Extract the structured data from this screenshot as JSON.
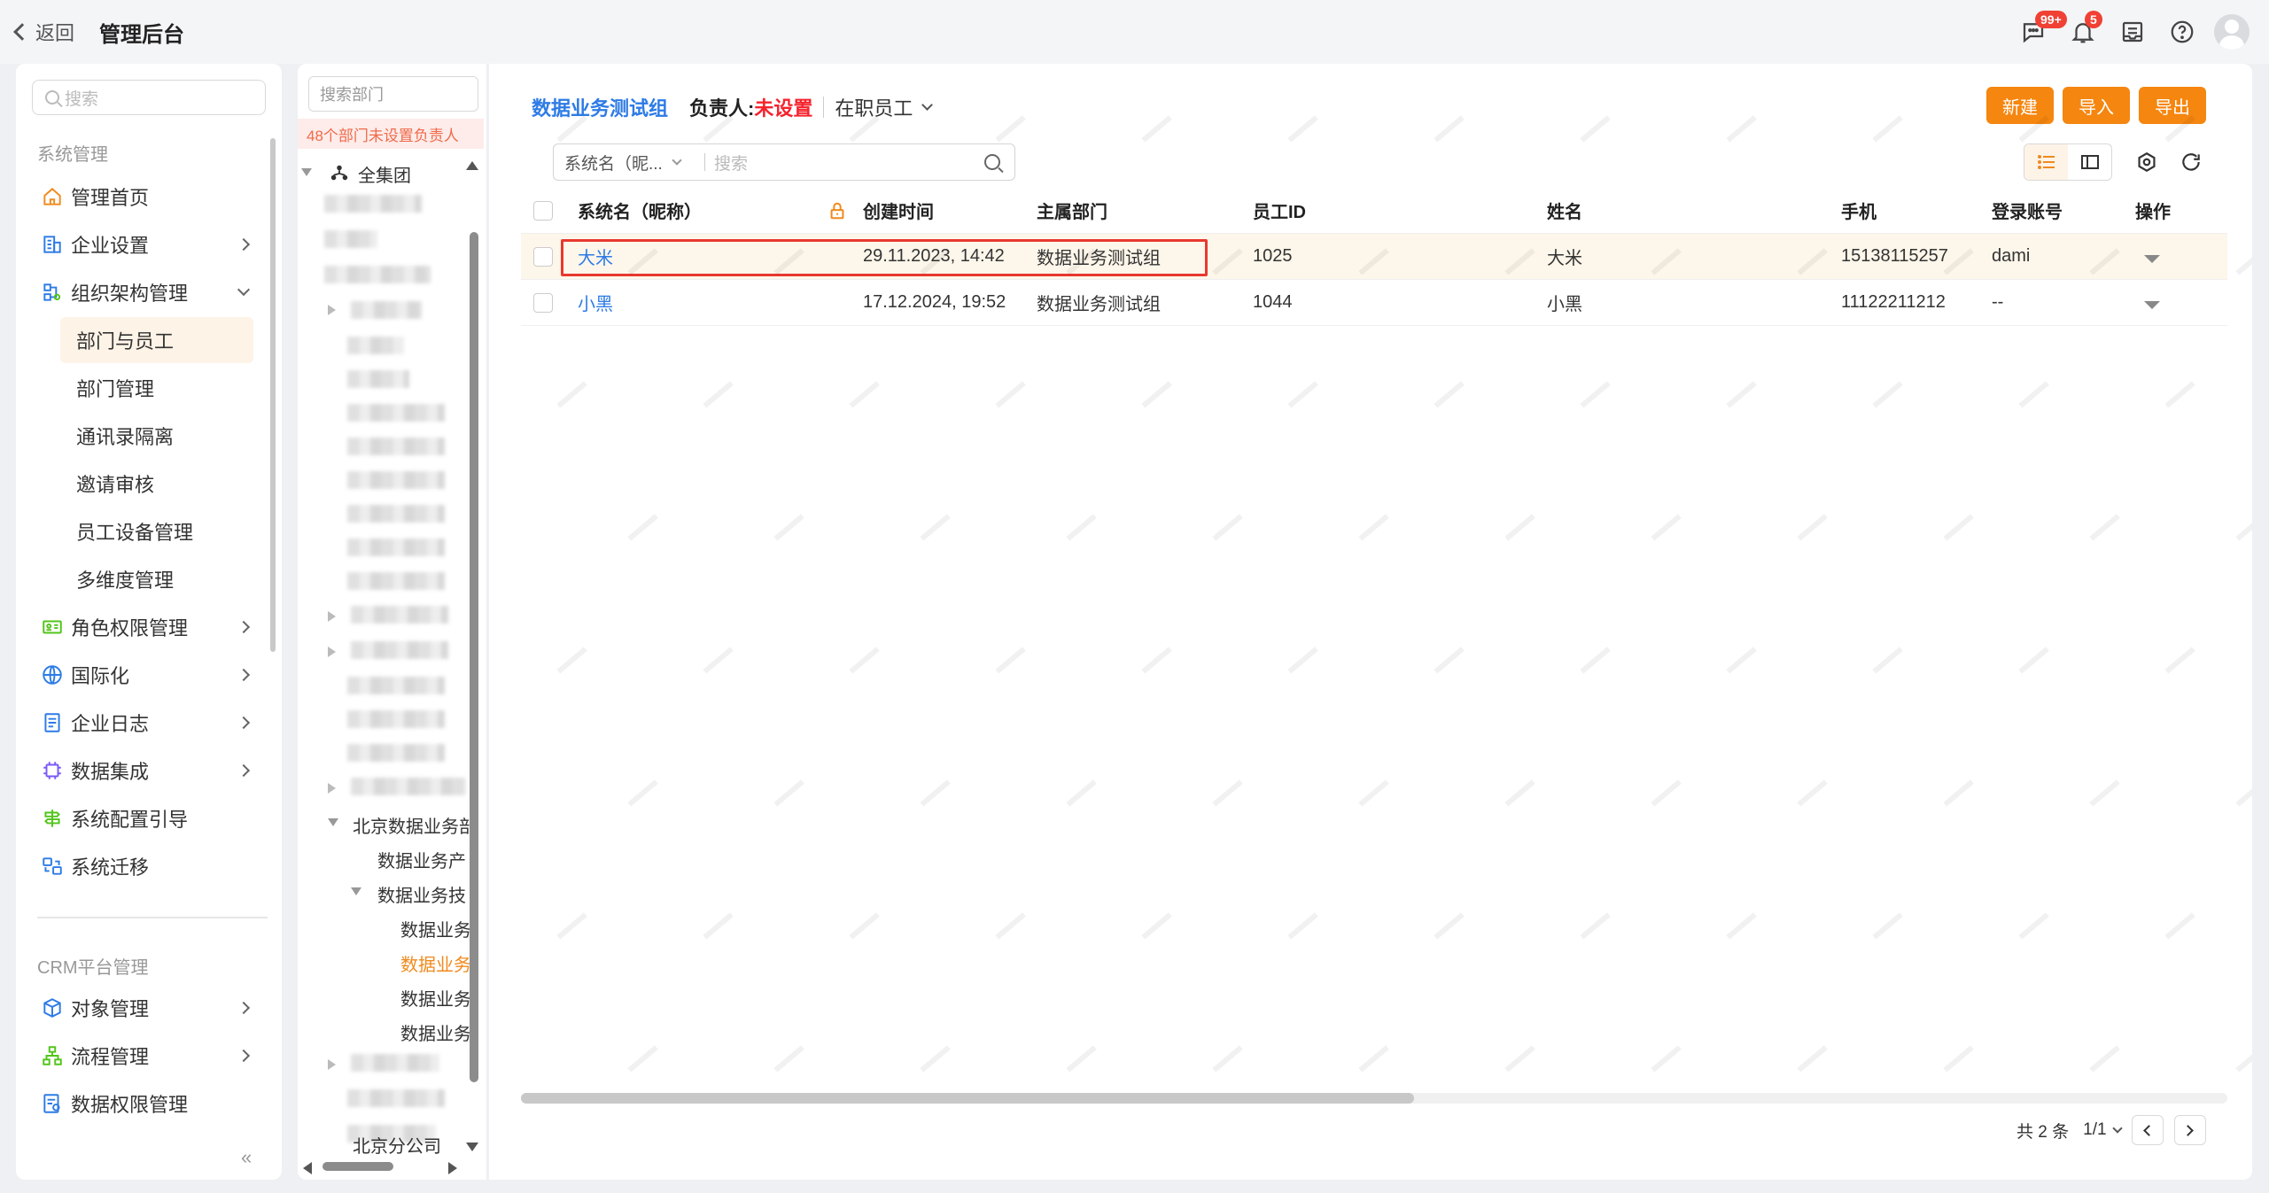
{
  "topbar": {
    "back_label": "返回",
    "title": "管理后台",
    "chat_badge": "99+",
    "bell_badge": "5"
  },
  "sidebar": {
    "search_placeholder": "搜索",
    "group_system": "系统管理",
    "group_crm": "CRM平台管理",
    "items": [
      {
        "label": "管理首页",
        "icon": "home-icon"
      },
      {
        "label": "企业设置",
        "icon": "building-icon"
      },
      {
        "label": "组织架构管理",
        "icon": "org-icon"
      },
      {
        "label": "角色权限管理",
        "icon": "role-icon"
      },
      {
        "label": "国际化",
        "icon": "globe-icon"
      },
      {
        "label": "企业日志",
        "icon": "log-icon"
      },
      {
        "label": "数据集成",
        "icon": "chip-icon"
      },
      {
        "label": "系统配置引导",
        "icon": "signpost-icon"
      },
      {
        "label": "系统迁移",
        "icon": "migrate-icon"
      }
    ],
    "org_subitems": [
      "部门与员工",
      "部门管理",
      "通讯录隔离",
      "邀请审核",
      "员工设备管理",
      "多维度管理"
    ],
    "crm_items": [
      {
        "label": "对象管理",
        "icon": "object-icon"
      },
      {
        "label": "流程管理",
        "icon": "flow-icon"
      },
      {
        "label": "数据权限管理",
        "icon": "data-perm-icon"
      }
    ],
    "collapse_label": "«"
  },
  "tree": {
    "search_placeholder": "搜索部门",
    "warning": "48个部门未设置负责人",
    "root": "全集团",
    "beijing_group": "北京数据业务部",
    "data_product": "数据业务产",
    "data_tech": "数据业务技",
    "leaf1": "数据业务",
    "leaf_active": "数据业务",
    "leaf3": "数据业务",
    "leaf4": "数据业务",
    "beijing_branch": "北京分公司"
  },
  "main": {
    "dept_title": "数据业务测试组",
    "owner_label": "负责人:",
    "owner_value": "未设置",
    "status": "在职员工",
    "btn_new": "新建",
    "btn_import": "导入",
    "btn_export": "导出",
    "filter_field": "系统名（昵...",
    "filter_placeholder": "搜索"
  },
  "table": {
    "columns": [
      "系统名（昵称）",
      "创建时间",
      "主属部门",
      "员工ID",
      "姓名",
      "手机",
      "登录账号",
      "操作"
    ],
    "rows": [
      {
        "nickname": "大米",
        "created": "29.11.2023, 14:42",
        "dept": "数据业务测试组",
        "id": "1025",
        "name": "大米",
        "phone": "15138115257",
        "account": "dami"
      },
      {
        "nickname": "小黑",
        "created": "17.12.2024, 19:52",
        "dept": "数据业务测试组",
        "id": "1044",
        "name": "小黑",
        "phone": "11122211212",
        "account": "--"
      }
    ]
  },
  "pager": {
    "total": "共 2 条",
    "page": "1/1"
  },
  "colors": {
    "accent": "#f5860f",
    "link": "#2d7be5",
    "danger": "#f5222d"
  }
}
